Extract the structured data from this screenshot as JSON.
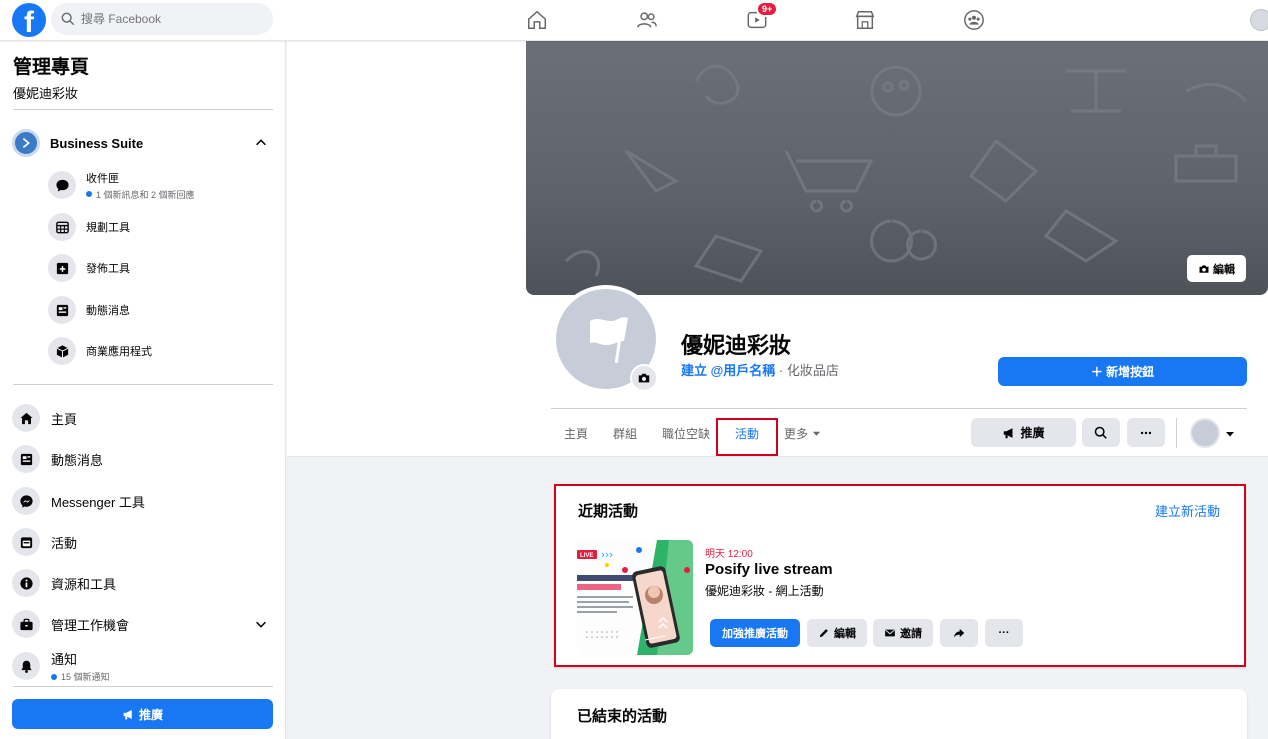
{
  "topbar": {
    "logo_letter": "f",
    "search_placeholder": "搜尋 Facebook",
    "video_badge": "9+"
  },
  "sidebar": {
    "title": "管理專頁",
    "page_name": "優妮迪彩妝",
    "business_suite": "Business Suite",
    "sub_items": [
      {
        "label": "收件匣",
        "note": "1 個新訊息和 2 個新回應"
      },
      {
        "label": "規劃工具"
      },
      {
        "label": "發佈工具"
      },
      {
        "label": "動態消息"
      },
      {
        "label": "商業應用程式"
      }
    ],
    "main_items": [
      {
        "label": "主頁"
      },
      {
        "label": "動態消息"
      },
      {
        "label": "Messenger 工具"
      },
      {
        "label": "活動"
      },
      {
        "label": "資源和工具"
      },
      {
        "label": "管理工作機會"
      },
      {
        "label": "通知",
        "note": "15 個新通知"
      }
    ],
    "promote": "推廣"
  },
  "header": {
    "cover_edit": "編輯",
    "page_title": "優妮迪彩妝",
    "create_username": "建立 @用戶名稱",
    "category": " · 化妝品店",
    "add_button": "＋ 新增按鈕",
    "tabs": [
      "主頁",
      "群組",
      "職位空缺",
      "活動",
      "更多"
    ],
    "promote": "推廣"
  },
  "recent_events": {
    "title": "近期活動",
    "create_link": "建立新活動",
    "event": {
      "time": "明天 12:00",
      "name": "Posify live stream",
      "subtitle": "優妮迪彩妝 - 網上活動",
      "boost": "加強推廣活動",
      "edit": "編輯",
      "invite": "邀請",
      "more": "···"
    },
    "thumb_live": "LIVE"
  },
  "past_events": {
    "title": "已結束的活動"
  },
  "colors": {
    "brand": "#1877f2",
    "highlight": "#d0021b",
    "badge": "#e41e3f"
  }
}
